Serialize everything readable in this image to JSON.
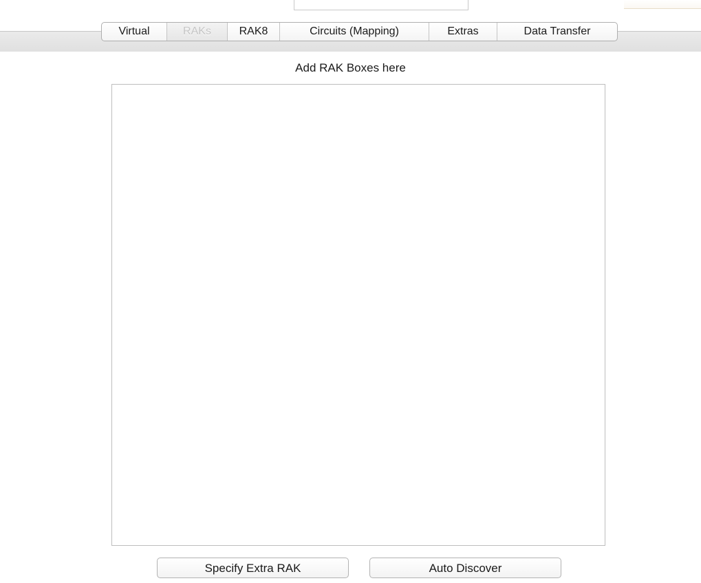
{
  "tabs": [
    {
      "label": "Virtual",
      "selected": false
    },
    {
      "label": "RAKs",
      "selected": true
    },
    {
      "label": "RAK8",
      "selected": false
    },
    {
      "label": "Circuits (Mapping)",
      "selected": false
    },
    {
      "label": "Extras",
      "selected": false
    },
    {
      "label": "Data Transfer",
      "selected": false
    }
  ],
  "panel": {
    "title": "Add RAK Boxes here",
    "items": []
  },
  "buttons": {
    "specify_extra": "Specify Extra RAK",
    "auto_discover": "Auto Discover"
  }
}
